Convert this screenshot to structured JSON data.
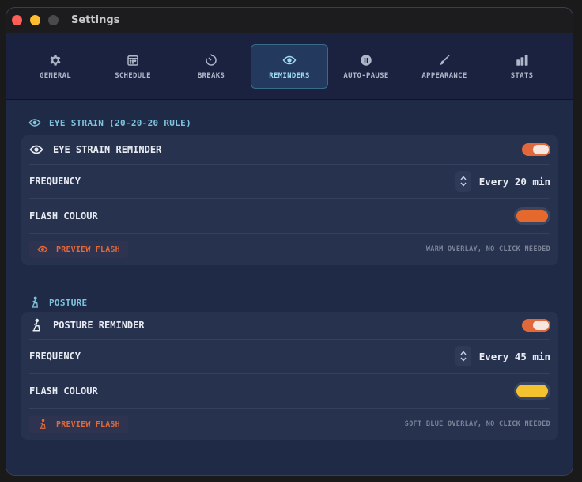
{
  "window": {
    "title": "Settings"
  },
  "tabs": [
    {
      "label": "GENERAL",
      "icon": "gear-icon"
    },
    {
      "label": "SCHEDULE",
      "icon": "calendar-icon"
    },
    {
      "label": "BREAKS",
      "icon": "timer-icon"
    },
    {
      "label": "REMINDERS",
      "icon": "eye-icon",
      "active": true
    },
    {
      "label": "AUTO-PAUSE",
      "icon": "pause-icon"
    },
    {
      "label": "APPEARANCE",
      "icon": "brush-icon"
    },
    {
      "label": "STATS",
      "icon": "bar-chart-icon"
    }
  ],
  "eye": {
    "section_title": "EYE STRAIN (20-20-20 RULE)",
    "reminder_label": "EYE STRAIN REMINDER",
    "enabled": true,
    "frequency_label": "FREQUENCY",
    "frequency_value": "Every 20 min",
    "colour_label": "FLASH COLOUR",
    "colour": "#e5692c",
    "preview_label": "PREVIEW FLASH",
    "hint": "WARM OVERLAY, NO CLICK NEEDED"
  },
  "posture": {
    "section_title": "POSTURE",
    "reminder_label": "POSTURE REMINDER",
    "enabled": true,
    "frequency_label": "FREQUENCY",
    "frequency_value": "Every 45 min",
    "colour_label": "FLASH COLOUR",
    "colour": "#f4c12f",
    "preview_label": "PREVIEW FLASH",
    "hint": "SOFT BLUE OVERLAY, NO CLICK NEEDED"
  },
  "colors": {
    "accent": "#e0683a",
    "section_header": "#7fc4dc",
    "active_tab": "#9fdcf0"
  }
}
